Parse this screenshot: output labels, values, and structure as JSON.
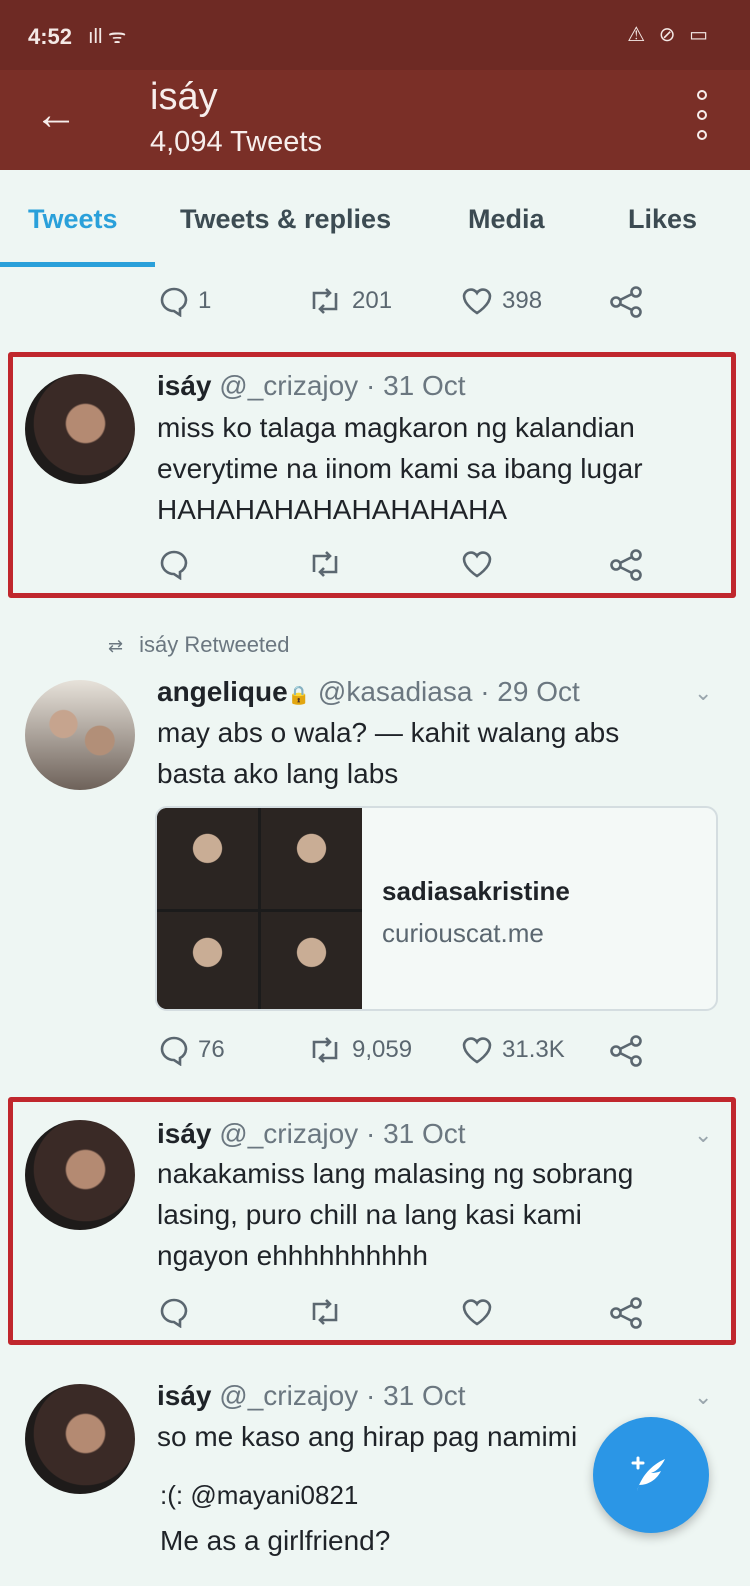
{
  "status_bar": {
    "time": "4:52",
    "signal": "ıll ᯤ",
    "right_icons": "⚠ ⊘ ▭"
  },
  "header": {
    "title": "isáy",
    "subtitle": "4,094 Tweets"
  },
  "tabs": [
    {
      "label": "Tweets",
      "active": true
    },
    {
      "label": "Tweets & replies"
    },
    {
      "label": "Media"
    },
    {
      "label": "Likes"
    }
  ],
  "top_actions": {
    "replies": "1",
    "retweets": "201",
    "likes": "398"
  },
  "tweets": [
    {
      "name": "isáy",
      "handle_date": " @_crizajoy · 31 Oct",
      "lines": [
        "miss ko talaga magkaron ng kalandian",
        "everytime na iinom kami sa ibang lugar",
        "HAHAHAHAHAHAHAHAHA"
      ]
    },
    {
      "retweet_label": "isáy Retweeted",
      "name": "angelique",
      "badge": "🔒",
      "handle_date": " @kasadiasa · 29 Oct",
      "lines": [
        "may abs o wala? — kahit walang abs",
        "basta ako lang labs"
      ],
      "card": {
        "title": "sadiasakristine",
        "domain": "curiouscat.me"
      },
      "replies": "76",
      "retweets": "9,059",
      "likes": "31.3K"
    },
    {
      "name": "isáy",
      "handle_date": " @_crizajoy · 31 Oct",
      "lines": [
        "nakakamiss lang malasing ng sobrang",
        "lasing, puro chill na lang kasi kami",
        "ngayon ehhhhhhhhhh"
      ]
    },
    {
      "name": "isáy",
      "handle_date": " @_crizajoy · 31 Oct",
      "lines": [
        "so me kaso ang hirap pag namimi"
      ],
      "quote": {
        "handle": ":(: @mayani0821",
        "text": "Me as a girlfriend?"
      }
    }
  ],
  "colors": {
    "accent": "#2aa0da",
    "header": "#7a2f27",
    "highlight": "#c0272d",
    "fab": "#2b96e6"
  },
  "icons": [
    "arrow-left-icon",
    "more-vertical-icon",
    "reply-icon",
    "retweet-icon",
    "heart-icon",
    "share-icon",
    "chevron-down-icon",
    "compose-icon"
  ]
}
